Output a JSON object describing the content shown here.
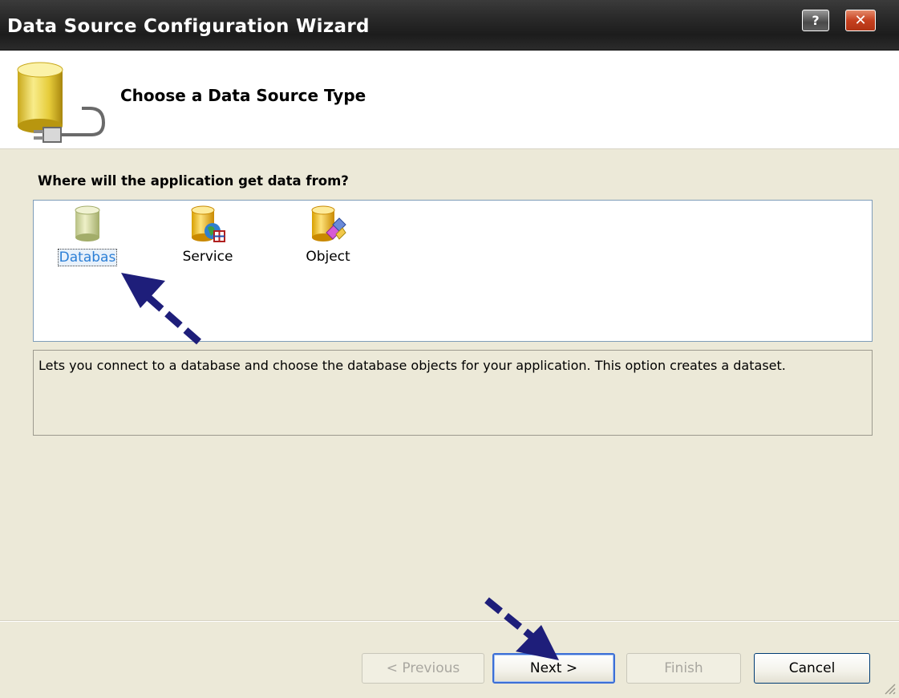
{
  "window": {
    "title": "Data Source Configuration Wizard",
    "help_label": "?",
    "close_label": "✕"
  },
  "header": {
    "title": "Choose a Data Source Type",
    "icon": "database-plug-icon"
  },
  "prompt": "Where will the application get data from?",
  "sources": [
    {
      "label": "Databas",
      "icon": "database-icon",
      "selected": true
    },
    {
      "label": "Service",
      "icon": "service-icon",
      "selected": false
    },
    {
      "label": "Object",
      "icon": "object-icon",
      "selected": false
    }
  ],
  "description": "Lets you connect to a database and choose the database objects for your application. This option creates a dataset.",
  "buttons": {
    "previous": "< Previous",
    "next": "Next >",
    "finish": "Finish",
    "cancel": "Cancel"
  },
  "colors": {
    "annotation_arrow": "#1e1e7a",
    "selection_text": "#2b7fd6"
  }
}
